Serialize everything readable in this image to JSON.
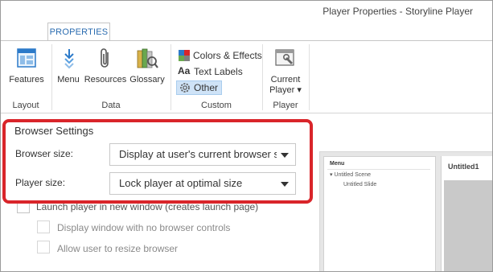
{
  "window": {
    "title": "Player Properties - Storyline Player"
  },
  "ribbon": {
    "tab": "PROPERTIES",
    "groups": {
      "layout": {
        "label": "Layout",
        "features": "Features"
      },
      "data": {
        "label": "Data",
        "menu": "Menu",
        "resources": "Resources",
        "glossary": "Glossary"
      },
      "custom": {
        "label": "Custom",
        "colors_effects": "Colors & Effects",
        "text_labels": "Text Labels",
        "other": "Other"
      },
      "player": {
        "label": "Player",
        "current_player_line1": "Current",
        "current_player_line2": "Player ▾"
      }
    }
  },
  "browser_settings": {
    "title": "Browser Settings",
    "browser_size_label": "Browser size:",
    "browser_size_value": "Display at user's current browser size",
    "player_size_label": "Player size:",
    "player_size_value": "Lock player at optimal size",
    "launch_new_window": "Launch player in new window (creates launch page)",
    "no_browser_controls": "Display window with no browser controls",
    "allow_resize": "Allow user to resize browser"
  },
  "preview": {
    "menu_title": "Menu",
    "scene": "▾ Untitled Scene",
    "slide": "Untitled Slide",
    "slide_title": "Untitled1"
  },
  "colors": {
    "accent": "#2b6cb0",
    "highlight_border": "#d9252a",
    "selected_bg": "#cfe3f7"
  }
}
